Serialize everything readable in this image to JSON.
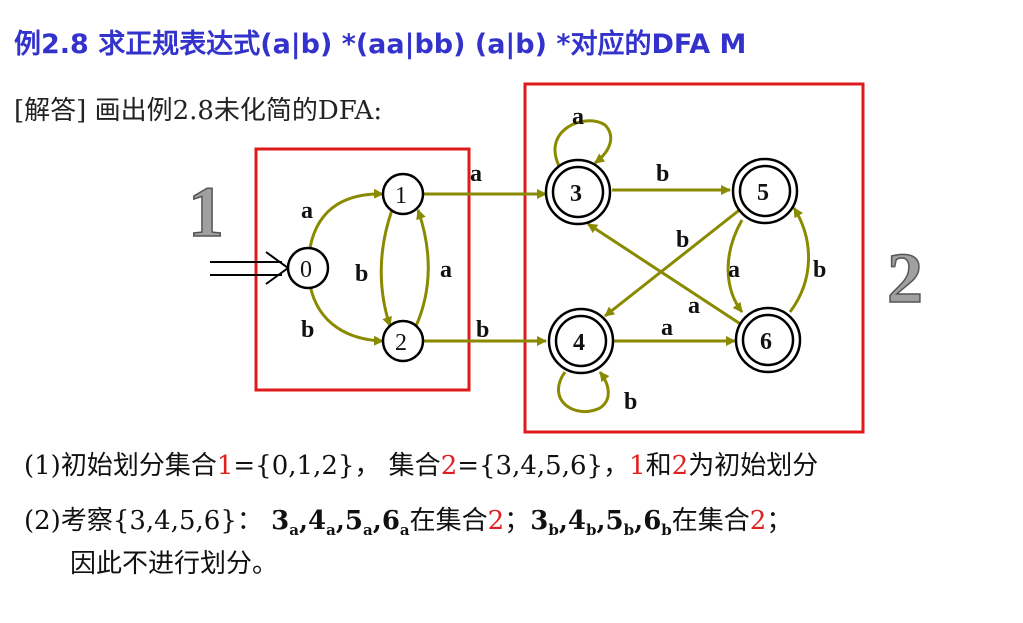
{
  "title": "例2.8  求正规表达式(a|b) *(aa|bb) (a|b) *对应的DFA  M",
  "answer": {
    "bracket": "[解答]",
    "text": "画出例2.8未化简的DFA:"
  },
  "diagram": {
    "group_labels": [
      "1",
      "2"
    ],
    "states": [
      {
        "id": "0",
        "final": false
      },
      {
        "id": "1",
        "final": false
      },
      {
        "id": "2",
        "final": false
      },
      {
        "id": "3",
        "final": true
      },
      {
        "id": "4",
        "final": true
      },
      {
        "id": "5",
        "final": true
      },
      {
        "id": "6",
        "final": true
      }
    ],
    "transitions": [
      {
        "from": "0",
        "to": "1",
        "label": "a"
      },
      {
        "from": "0",
        "to": "2",
        "label": "b"
      },
      {
        "from": "1",
        "to": "2",
        "label": "b"
      },
      {
        "from": "2",
        "to": "1",
        "label": "a"
      },
      {
        "from": "1",
        "to": "3",
        "label": "a"
      },
      {
        "from": "2",
        "to": "4",
        "label": "b"
      },
      {
        "from": "3",
        "to": "3",
        "label": "a"
      },
      {
        "from": "3",
        "to": "5",
        "label": "b"
      },
      {
        "from": "5",
        "to": "4",
        "label": "b"
      },
      {
        "from": "4",
        "to": "6",
        "label": "a"
      },
      {
        "from": "6",
        "to": "3",
        "label": "a"
      },
      {
        "from": "5",
        "to": "6",
        "label": "a"
      },
      {
        "from": "6",
        "to": "5",
        "label": "b"
      },
      {
        "from": "4",
        "to": "4",
        "label": "b"
      }
    ],
    "colors": {
      "edge": "#8a8a00",
      "box": "#e01a1a",
      "state": "#000000"
    }
  },
  "line1": {
    "prefix": "(1)初始划分集合",
    "set1_name": "1",
    "set1_value": "={0,1,2}，  集合",
    "set2_name": "2",
    "set2_value": "={3,4,5,6}，",
    "n1": "1",
    "and": "和",
    "n2": "2",
    "suffix": "为初始划分"
  },
  "line2": {
    "prefix": "(2)考察{3,4,5,6}：  ",
    "a_terms": [
      {
        "num": "3",
        "sub": "a",
        "sep": ","
      },
      {
        "num": "4",
        "sub": "a",
        "sep": ","
      },
      {
        "num": "5",
        "sub": "a",
        "sep": ","
      },
      {
        "num": "6",
        "sub": "a",
        "sep": ""
      }
    ],
    "in_set_a": "在集合",
    "set_a": "2",
    "punct_a": "；",
    "b_terms": [
      {
        "num": "3",
        "sub": "b",
        "sep": ","
      },
      {
        "num": "4",
        "sub": "b",
        "sep": ","
      },
      {
        "num": "5",
        "sub": "b",
        "sep": ","
      },
      {
        "num": "6",
        "sub": "b",
        "sep": ""
      }
    ],
    "in_set_b": "在集合",
    "set_b": "2",
    "punct_b": "；"
  },
  "line3": {
    "text": "因此不进行划分。"
  }
}
